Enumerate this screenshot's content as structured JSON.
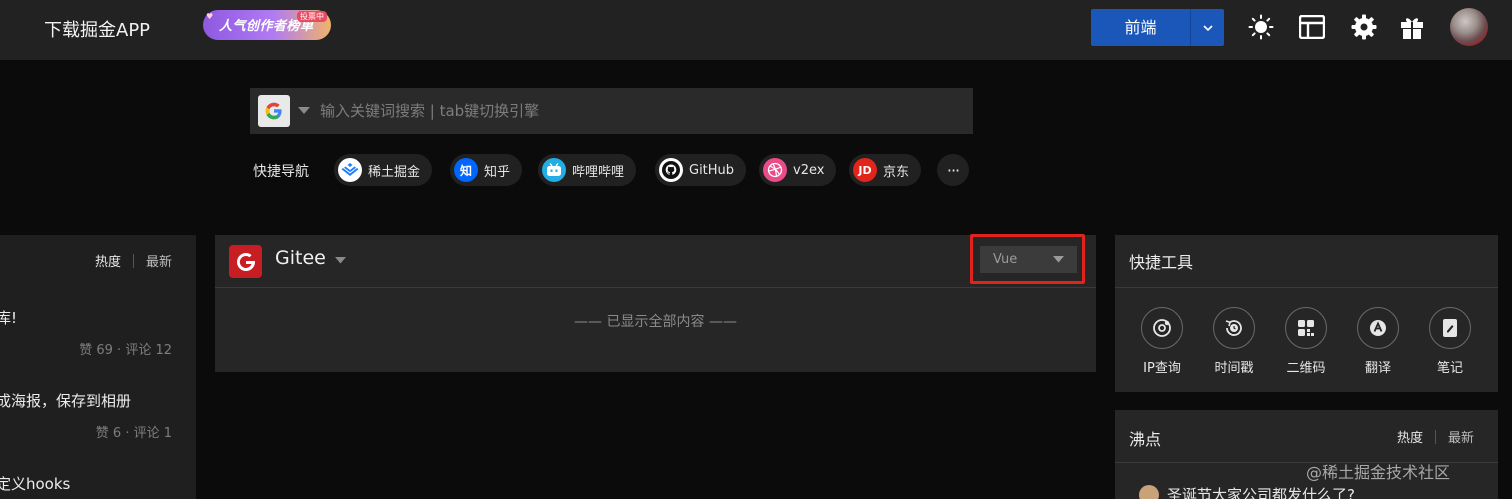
{
  "header": {
    "download_app": "下载掘金APP",
    "creator_badge": {
      "label": "人气创作者榜单",
      "tag": "投票中"
    },
    "category_button": {
      "label": "前端"
    },
    "icons": [
      "sun-icon",
      "layout-icon",
      "gear-icon",
      "gift-icon"
    ]
  },
  "search": {
    "engine": "google",
    "placeholder": "输入关键词搜索 | tab键切换引擎"
  },
  "quick_nav": {
    "label": "快捷导航",
    "items": [
      {
        "label": "稀土掘金",
        "icon": "juejin-icon",
        "color": "#1e80ff"
      },
      {
        "label": "知乎",
        "icon": "zhihu-icon",
        "icon_text": "知",
        "color": "#0066ff"
      },
      {
        "label": "哔哩哔哩",
        "icon": "bilibili-icon",
        "color": "#23ade5"
      },
      {
        "label": "GitHub",
        "icon": "github-icon",
        "color": "#ffffff"
      },
      {
        "label": "v2ex",
        "icon": "dribbble-icon",
        "color": "#ea4c89"
      },
      {
        "label": "京东",
        "icon": "jd-icon",
        "icon_text": "JD",
        "color": "#e1251b"
      }
    ],
    "more": "···"
  },
  "left_panel": {
    "tabs": {
      "hot": "热度",
      "new": "最新"
    },
    "items": [
      {
        "title": "库!",
        "meta": "赞 69 · 评论 12"
      },
      {
        "title": "成海报，保存到相册",
        "meta": "赞 6 · 评论 1"
      },
      {
        "title": "定义hooks",
        "meta": ""
      }
    ]
  },
  "gitee_panel": {
    "source": "Gitee",
    "logo_letter": "G",
    "language_select": "Vue",
    "empty_text": "—— 已显示全部内容 ——",
    "accent": "#c71d23",
    "highlight_color": "#e0241b"
  },
  "tools_panel": {
    "title": "快捷工具",
    "tools": [
      {
        "label": "IP查询",
        "icon": "location-icon"
      },
      {
        "label": "时间戳",
        "icon": "clock-icon"
      },
      {
        "label": "二维码",
        "icon": "qrcode-icon"
      },
      {
        "label": "翻译",
        "icon": "translate-icon"
      },
      {
        "label": "笔记",
        "icon": "note-icon"
      }
    ]
  },
  "hot_panel": {
    "title": "沸点",
    "tabs": {
      "hot": "热度",
      "new": "最新"
    },
    "first_post": "圣诞节大家公司都发什么了?"
  },
  "watermark": "@稀土掘金技术社区",
  "colors": {
    "primary_button": "#1b57b8",
    "background": "#0b0b0b",
    "panel": "#262626"
  }
}
